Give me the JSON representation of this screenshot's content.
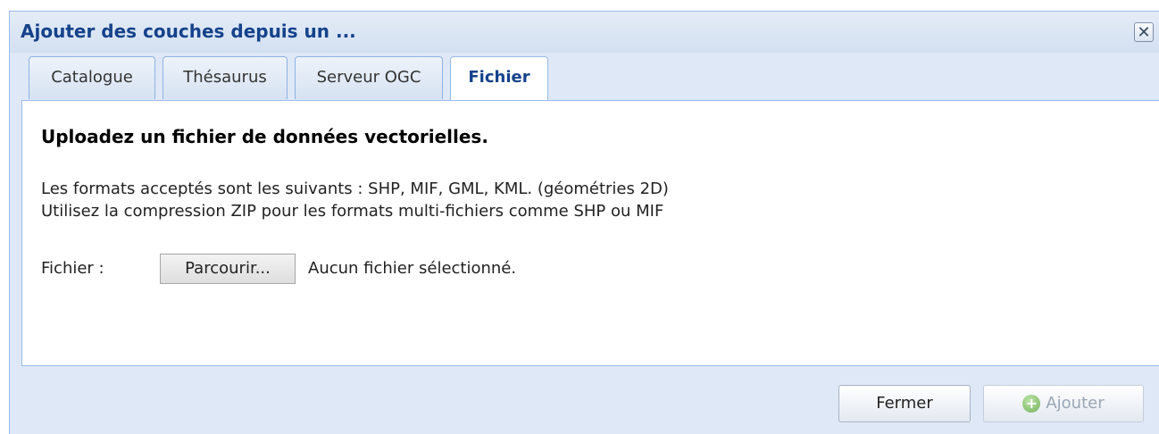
{
  "window": {
    "title": "Ajouter des couches depuis un ..."
  },
  "tabs": [
    {
      "label": "Catalogue",
      "active": false
    },
    {
      "label": "Thésaurus",
      "active": false
    },
    {
      "label": "Serveur OGC",
      "active": false
    },
    {
      "label": "Fichier",
      "active": true
    }
  ],
  "content": {
    "heading": "Uploadez un fichier de données vectorielles.",
    "line1": "Les formats acceptés sont les suivants : SHP, MIF, GML, KML. (géométries 2D)",
    "line2": "Utilisez la compression ZIP pour les formats multi-fichiers comme SHP ou MIF",
    "file_label": "Fichier :",
    "browse_label": "Parcourir...",
    "file_status": "Aucun fichier sélectionné."
  },
  "footer": {
    "close_label": "Fermer",
    "add_label": "Ajouter",
    "add_enabled": false
  },
  "icons": {
    "close": "close-icon",
    "add": "plus-circle-icon"
  },
  "colors": {
    "title": "#15428b",
    "window_bg": "#dfe8f6",
    "border": "#99bbe8"
  }
}
